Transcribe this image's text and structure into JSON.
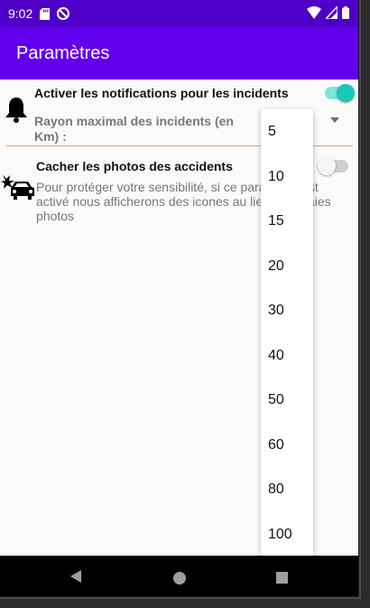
{
  "status": {
    "time": "9:02",
    "left_icons": [
      "sd-card-icon",
      "no-disturb-icon"
    ],
    "right_icons": [
      "wifi-icon",
      "signal-icon",
      "battery-icon"
    ]
  },
  "appbar": {
    "title": "Paramètres"
  },
  "notifications": {
    "title": "Activer les notifications pour les incidents",
    "toggle_on": true,
    "radius_label": "Rayon maximal des incidents (en Km) :"
  },
  "photos": {
    "title": "Cacher les photos des accidents",
    "description": "Pour protéger votre sensibilité, si ce paramètre est activé nous afficherons des icones au lieu des vraies photos",
    "toggle_on": false
  },
  "dropdown": {
    "options": [
      "5",
      "10",
      "15",
      "20",
      "30",
      "40",
      "50",
      "60",
      "80",
      "100"
    ]
  },
  "colors": {
    "status_bar": "#4e00c8",
    "app_bar": "#6200ee",
    "toggle_accent": "#18c9b6",
    "divider": "#f0a040"
  },
  "navbar": {
    "icons": [
      "back-icon",
      "home-icon",
      "recents-icon"
    ]
  }
}
